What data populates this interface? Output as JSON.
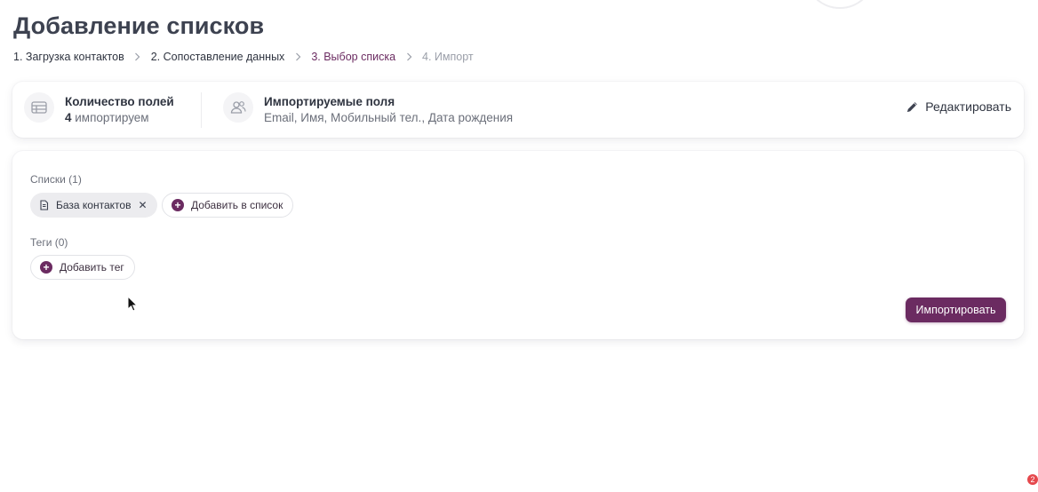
{
  "page": {
    "title": "Добавление списков"
  },
  "steps": [
    {
      "label": "1. Загрузка контактов",
      "state": "done"
    },
    {
      "label": "2. Сопоставление данных",
      "state": "done"
    },
    {
      "label": "3. Выбор списка",
      "state": "active"
    },
    {
      "label": "4. Импорт",
      "state": "pending"
    }
  ],
  "summary": {
    "fields_count": {
      "title": "Количество полей",
      "count": "4",
      "suffix": " импортируем",
      "icon": "table-icon"
    },
    "imported_fields": {
      "title": "Импортируемые поля",
      "value": "Email, Имя, Мобильный тел., Дата рождения",
      "icon": "users-icon"
    },
    "edit_label": "Редактировать"
  },
  "lists": {
    "label": "Списки (1)",
    "items": [
      {
        "label": "База контактов",
        "icon": "document-icon"
      }
    ],
    "add_label": "Добавить в список"
  },
  "tags": {
    "label": "Теги (0)",
    "add_label": "Добавить тег"
  },
  "actions": {
    "import_label": "Импортировать"
  },
  "notifications": {
    "count": "2"
  },
  "colors": {
    "accent": "#6b2b61",
    "badge": "#e5484d",
    "text": "#2f3440",
    "muted": "#6b6f7a"
  }
}
